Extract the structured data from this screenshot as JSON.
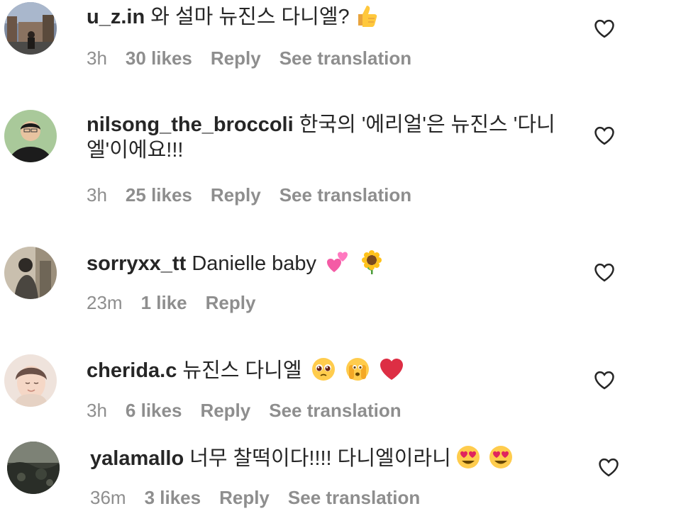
{
  "comments": [
    {
      "username": "u_z.in",
      "text": "와 설마 뉴진스 다니엘?",
      "emojis": [
        "thumbs-up-emoji"
      ],
      "time": "3h",
      "likes": "30 likes",
      "reply": "Reply",
      "translate": "See translation"
    },
    {
      "username": "nilsong_the_broccoli",
      "text": "한국의 '에리얼'은 뉴진스 '다니엘'이에요!!!",
      "emojis": [],
      "time": "3h",
      "likes": "25 likes",
      "reply": "Reply",
      "translate": "See translation"
    },
    {
      "username": "sorryxx_tt",
      "text": "Danielle baby",
      "emojis": [
        "two-hearts-emoji",
        "sunflower-emoji"
      ],
      "time": "23m",
      "likes": "1 like",
      "reply": "Reply",
      "translate": ""
    },
    {
      "username": "cherida.c",
      "text": "뉴진스 다니엘",
      "emojis": [
        "pleading-face-emoji",
        "face-holding-back-tears-emoji",
        "red-heart-emoji"
      ],
      "time": "3h",
      "likes": "6 likes",
      "reply": "Reply",
      "translate": "See translation"
    },
    {
      "username": "yalamallo",
      "text": "너무 찰떡이다!!!! 다니엘이라니",
      "emojis": [
        "heart-eyes-emoji",
        "heart-eyes-emoji"
      ],
      "time": "36m",
      "likes": "3 likes",
      "reply": "Reply",
      "translate": "See translation"
    }
  ],
  "colors": {
    "text": "#262626",
    "secondary": "#8e8e8e",
    "background": "#ffffff"
  },
  "icons": {
    "like": "heart-outline-icon"
  }
}
